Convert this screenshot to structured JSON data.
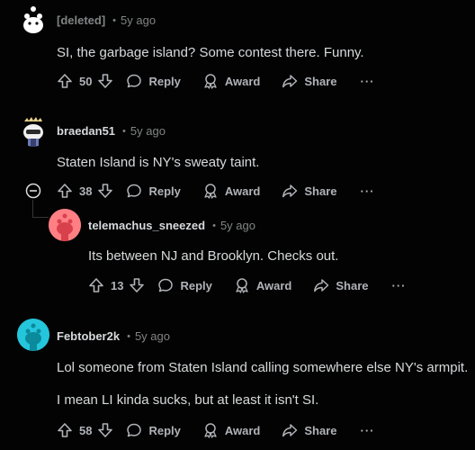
{
  "comments": [
    {
      "username": "[deleted]",
      "time": "5y ago",
      "body": [
        "SI, the garbage island? Some contest there. Funny."
      ],
      "score": "50",
      "reply_label": "Reply",
      "award_label": "Award",
      "share_label": "Share",
      "more_label": "···"
    },
    {
      "username": "braedan51",
      "time": "5y ago",
      "body": [
        "Staten Island is NY's sweaty taint."
      ],
      "score": "38",
      "reply_label": "Reply",
      "award_label": "Award",
      "share_label": "Share",
      "more_label": "···"
    },
    {
      "username": "telemachus_sneezed",
      "time": "5y ago",
      "body": [
        "Its between NJ and Brooklyn. Checks out."
      ],
      "score": "13",
      "reply_label": "Reply",
      "award_label": "Award",
      "share_label": "Share",
      "more_label": "···"
    },
    {
      "username": "Febtober2k",
      "time": "5y ago",
      "body": [
        "Lol someone from Staten Island calling somewhere else NY's armpit.",
        "I mean LI kinda sucks, but at least it isn't SI."
      ],
      "score": "58",
      "reply_label": "Reply",
      "award_label": "Award",
      "share_label": "Share",
      "more_label": "···"
    }
  ],
  "separator": "•",
  "colors": {
    "background": "#030303",
    "text": "#d7dadc",
    "meta": "#818384",
    "avatar_pink": "#ff7f84",
    "avatar_teal": "#24c6dc"
  }
}
